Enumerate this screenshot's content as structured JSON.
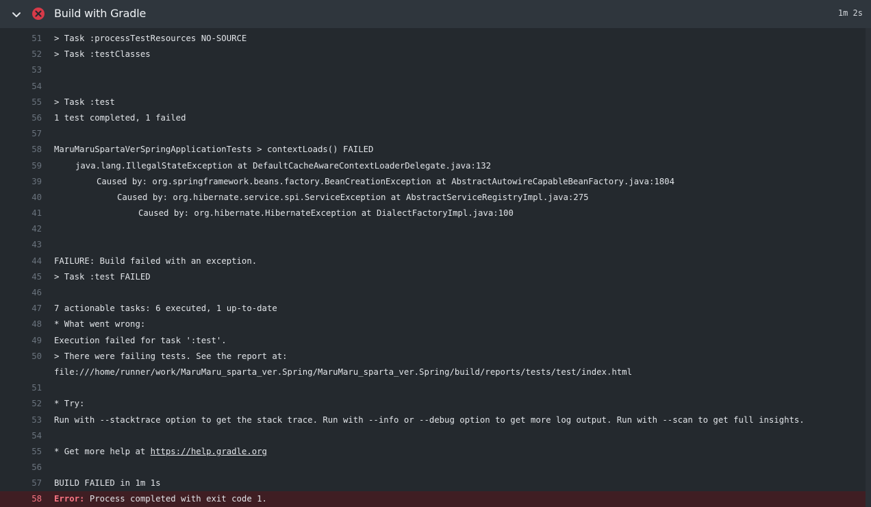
{
  "header": {
    "title": "Build with Gradle",
    "duration": "1m 2s",
    "status": "failed",
    "error_color": "#d73a49",
    "collapse_icon": "chevron-down-icon",
    "status_icon": "x-circle-icon"
  },
  "log": [
    {
      "n": "51",
      "text": "> Task :processTestResources NO-SOURCE"
    },
    {
      "n": "52",
      "text": "> Task :testClasses"
    },
    {
      "n": "53",
      "text": ""
    },
    {
      "n": "54",
      "text": ""
    },
    {
      "n": "55",
      "text": "> Task :test"
    },
    {
      "n": "56",
      "text": "1 test completed, 1 failed"
    },
    {
      "n": "57",
      "text": ""
    },
    {
      "n": "58",
      "text": "MaruMaruSpartaVerSpringApplicationTests > contextLoads() FAILED"
    },
    {
      "n": "59",
      "text": "java.lang.IllegalStateException at DefaultCacheAwareContextLoaderDelegate.java:132"
    },
    {
      "n": "39",
      "text": "Caused by: org.springframework.beans.factory.BeanCreationException at AbstractAutowireCapableBeanFactory.java:1804"
    },
    {
      "n": "40",
      "text": "Caused by: org.hibernate.service.spi.ServiceException at AbstractServiceRegistryImpl.java:275"
    },
    {
      "n": "41",
      "text": "Caused by: org.hibernate.HibernateException at DialectFactoryImpl.java:100"
    },
    {
      "n": "42",
      "text": ""
    },
    {
      "n": "43",
      "text": ""
    },
    {
      "n": "44",
      "text": "FAILURE: Build failed with an exception."
    },
    {
      "n": "45",
      "text": "> Task :test FAILED"
    },
    {
      "n": "46",
      "text": ""
    },
    {
      "n": "47",
      "text": "7 actionable tasks: 6 executed, 1 up-to-date"
    },
    {
      "n": "48",
      "text": "* What went wrong:"
    },
    {
      "n": "49",
      "text": "Execution failed for task ':test'."
    },
    {
      "n": "50",
      "text": "> There were failing tests. See the report at:"
    },
    {
      "n": "",
      "text": "file:///home/runner/work/MaruMaru_sparta_ver.Spring/MaruMaru_sparta_ver.Spring/build/reports/tests/test/index.html"
    },
    {
      "n": "51",
      "text": ""
    },
    {
      "n": "52",
      "text": "* Try:"
    },
    {
      "n": "53",
      "text": "Run with --stacktrace option to get the stack trace. Run with --info or --debug option to get more log output. Run with --scan to get full insights."
    },
    {
      "n": "54",
      "text": ""
    },
    {
      "n": "55",
      "text": "* Get more help at ",
      "link": "https://help.gradle.org"
    },
    {
      "n": "56",
      "text": ""
    },
    {
      "n": "57",
      "text": "BUILD FAILED in 1m 1s"
    },
    {
      "n": "58",
      "error_label": "Error:",
      "text": " Process completed with exit code 1."
    }
  ]
}
